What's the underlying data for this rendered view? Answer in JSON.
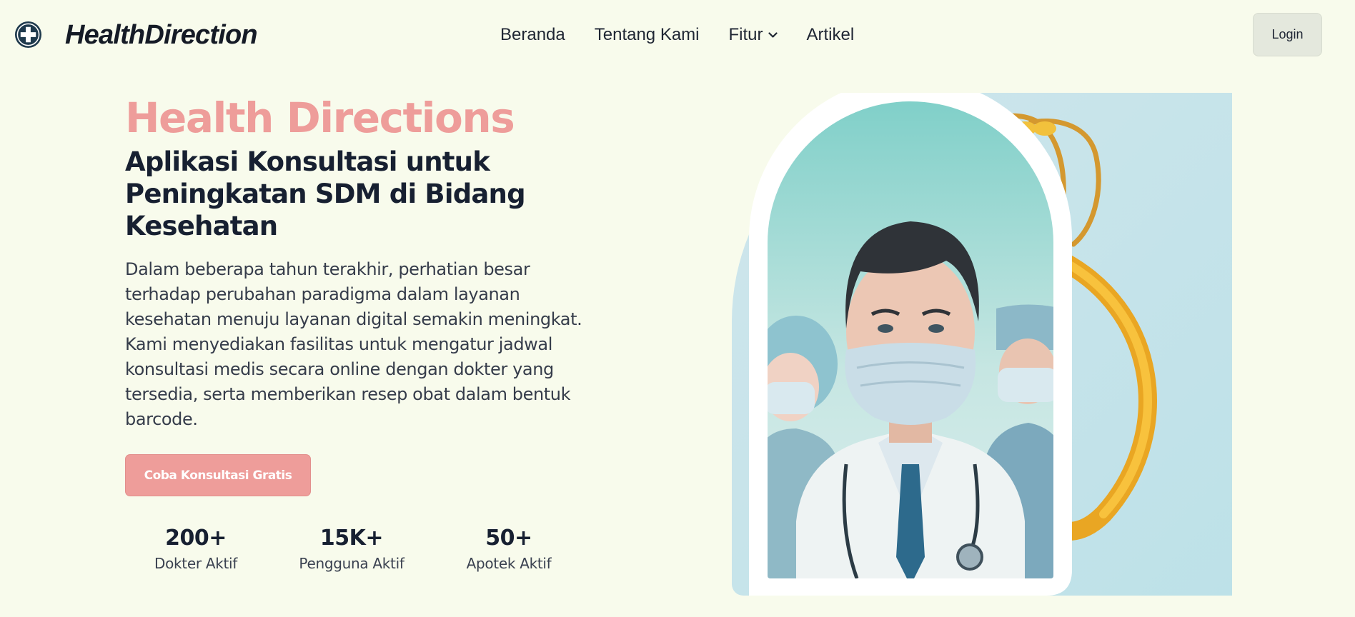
{
  "header": {
    "brand": "HealthDirection",
    "nav": [
      {
        "label": "Beranda"
      },
      {
        "label": "Tentang Kami"
      },
      {
        "label": "Fitur",
        "has_dropdown": true
      },
      {
        "label": "Artikel"
      }
    ],
    "login_label": "Login"
  },
  "hero": {
    "title": "Health Directions",
    "subtitle": "Aplikasi Konsultasi untuk Peningkatan SDM di Bidang Kesehatan",
    "description": "Dalam beberapa tahun terakhir, perhatian besar terhadap perubahan paradigma dalam layanan kesehatan menuju layanan digital semakin meningkat. Kami menyediakan fasilitas untuk mengatur jadwal konsultasi medis secara online dengan dokter yang tersedia, serta memberikan resep obat dalam bentuk barcode.",
    "cta_label": "Coba Konsultasi Gratis",
    "stats": [
      {
        "value": "200+",
        "label": "Dokter Aktif"
      },
      {
        "value": "15K+",
        "label": "Pengguna Aktif"
      },
      {
        "value": "50+",
        "label": "Apotek Aktif"
      }
    ]
  },
  "colors": {
    "background": "#f8fbec",
    "accent": "#ee9d9a",
    "heading": "#172031",
    "login_bg": "#e4e8dd"
  },
  "icons": {
    "logo": "medical-cross-icon",
    "dropdown": "chevron-down-icon"
  }
}
